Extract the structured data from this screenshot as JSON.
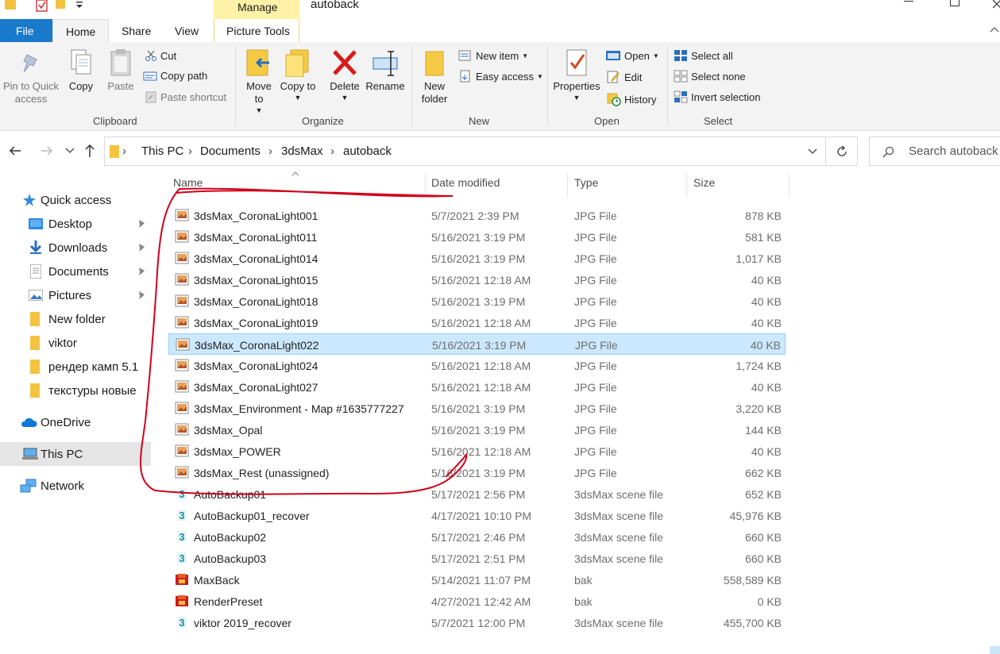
{
  "window": {
    "title": "autoback"
  },
  "qat": {
    "properties_icon": "checkbox-icon",
    "folder_icon": "folder-icon"
  },
  "ribbon_tabs": {
    "file": "File",
    "home": "Home",
    "share": "Share",
    "view": "View",
    "manage": "Manage",
    "picture_tools": "Picture Tools"
  },
  "clipboard": {
    "pin": "Pin to Quick access",
    "copy": "Copy",
    "paste": "Paste",
    "cut": "Cut",
    "copy_path": "Copy path",
    "paste_shortcut": "Paste shortcut",
    "label": "Clipboard"
  },
  "organize": {
    "move_to": "Move to",
    "copy_to": "Copy to",
    "delete": "Delete",
    "rename": "Rename",
    "label": "Organize"
  },
  "new_group": {
    "new_folder": "New folder",
    "new_item": "New item",
    "easy_access": "Easy access",
    "label": "New"
  },
  "open_group": {
    "properties": "Properties",
    "open": "Open",
    "edit": "Edit",
    "history": "History",
    "label": "Open"
  },
  "select_group": {
    "select_all": "Select all",
    "select_none": "Select none",
    "invert": "Invert selection",
    "label": "Select"
  },
  "breadcrumb": [
    "This PC",
    "Documents",
    "3dsMax",
    "autoback"
  ],
  "search": {
    "placeholder": "Search autoback"
  },
  "nav": {
    "quick_access": "Quick access",
    "desktop": "Desktop",
    "downloads": "Downloads",
    "documents": "Documents",
    "pictures": "Pictures",
    "new_folder": "New folder",
    "viktor": "viktor",
    "render": "рендер камп 5.1",
    "textures": "текстуры новые",
    "onedrive": "OneDrive",
    "this_pc": "This PC",
    "network": "Network"
  },
  "columns": {
    "name": "Name",
    "date": "Date modified",
    "type": "Type",
    "size": "Size"
  },
  "files": [
    {
      "name": "3dsMax_CoronaLight001",
      "date": "5/7/2021 2:39 PM",
      "type": "JPG File",
      "size": "878 KB",
      "icon": "jpg-icon"
    },
    {
      "name": "3dsMax_CoronaLight011",
      "date": "5/16/2021 3:19 PM",
      "type": "JPG File",
      "size": "581 KB",
      "icon": "jpg-icon"
    },
    {
      "name": "3dsMax_CoronaLight014",
      "date": "5/16/2021 3:19 PM",
      "type": "JPG File",
      "size": "1,017 KB",
      "icon": "jpg-icon"
    },
    {
      "name": "3dsMax_CoronaLight015",
      "date": "5/16/2021 12:18 AM",
      "type": "JPG File",
      "size": "40 KB",
      "icon": "jpg-icon"
    },
    {
      "name": "3dsMax_CoronaLight018",
      "date": "5/16/2021 3:19 PM",
      "type": "JPG File",
      "size": "40 KB",
      "icon": "jpg-icon"
    },
    {
      "name": "3dsMax_CoronaLight019",
      "date": "5/16/2021 12:18 AM",
      "type": "JPG File",
      "size": "40 KB",
      "icon": "jpg-icon"
    },
    {
      "name": "3dsMax_CoronaLight022",
      "date": "5/16/2021 3:19 PM",
      "type": "JPG File",
      "size": "40 KB",
      "icon": "jpg-icon"
    },
    {
      "name": "3dsMax_CoronaLight024",
      "date": "5/16/2021 12:18 AM",
      "type": "JPG File",
      "size": "1,724 KB",
      "icon": "jpg-icon"
    },
    {
      "name": "3dsMax_CoronaLight027",
      "date": "5/16/2021 12:18 AM",
      "type": "JPG File",
      "size": "40 KB",
      "icon": "jpg-icon"
    },
    {
      "name": "3dsMax_Environment - Map #1635777227",
      "date": "5/16/2021 3:19 PM",
      "type": "JPG File",
      "size": "3,220 KB",
      "icon": "jpg-icon"
    },
    {
      "name": "3dsMax_Opal",
      "date": "5/16/2021 3:19 PM",
      "type": "JPG File",
      "size": "144 KB",
      "icon": "jpg-icon"
    },
    {
      "name": "3dsMax_POWER",
      "date": "5/16/2021 12:18 AM",
      "type": "JPG File",
      "size": "40 KB",
      "icon": "jpg-icon"
    },
    {
      "name": "3dsMax_Rest (unassigned)",
      "date": "5/16/2021 3:19 PM",
      "type": "JPG File",
      "size": "662 KB",
      "icon": "jpg-icon"
    },
    {
      "name": "AutoBackup01",
      "date": "5/17/2021 2:56 PM",
      "type": "3dsMax scene file",
      "size": "652 KB",
      "icon": "max-icon"
    },
    {
      "name": "AutoBackup01_recover",
      "date": "4/17/2021 10:10 PM",
      "type": "3dsMax scene file",
      "size": "45,976 KB",
      "icon": "max-icon"
    },
    {
      "name": "AutoBackup02",
      "date": "5/17/2021 2:46 PM",
      "type": "3dsMax scene file",
      "size": "660 KB",
      "icon": "max-icon"
    },
    {
      "name": "AutoBackup03",
      "date": "5/17/2021 2:51 PM",
      "type": "3dsMax scene file",
      "size": "660 KB",
      "icon": "max-icon"
    },
    {
      "name": "MaxBack",
      "date": "5/14/2021 11:07 PM",
      "type": "bak",
      "size": "558,589 KB",
      "icon": "bak-icon"
    },
    {
      "name": "RenderPreset",
      "date": "4/27/2021 12:42 AM",
      "type": "bak",
      "size": "0 KB",
      "icon": "bak-icon"
    },
    {
      "name": "viktor 2019_recover",
      "date": "5/7/2021 12:00 PM",
      "type": "3dsMax scene file",
      "size": "455,700 KB",
      "icon": "max-icon"
    }
  ],
  "selected_row": "3dsMax_CoronaLight022",
  "colors": {
    "accent": "#0063b1",
    "selection": "#cce8ff",
    "manage_tab": "#fff2a8",
    "annotation": "#d0021b"
  }
}
